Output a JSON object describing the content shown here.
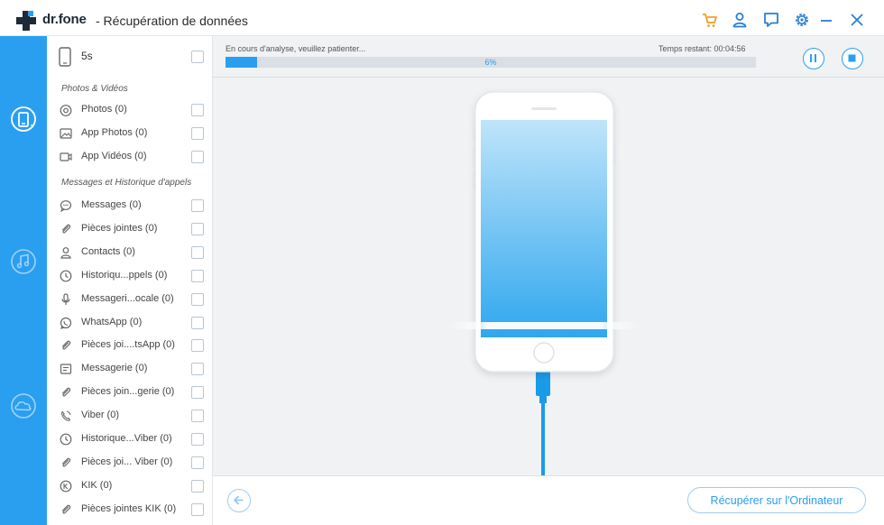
{
  "app": {
    "brand": "dr.fone",
    "title": "- Récupération de données"
  },
  "colors": {
    "accent": "#2a9ff0",
    "cart": "#f39c28",
    "rail": "#2a9ff0"
  },
  "titlebar_icons": [
    "cart-icon",
    "user-icon",
    "feedback-icon",
    "settings-icon",
    "minimize-icon",
    "close-icon"
  ],
  "rail_icons": [
    "device-recovery-icon",
    "itunes-recovery-icon",
    "icloud-recovery-icon"
  ],
  "device": {
    "label": "5s"
  },
  "sections": [
    {
      "title": "Photos & Vidéos",
      "items": [
        {
          "icon": "camera-icon",
          "label": "Photos (0)"
        },
        {
          "icon": "image-icon",
          "label": "App Photos (0)"
        },
        {
          "icon": "video-icon",
          "label": "App Vidéos (0)"
        }
      ]
    },
    {
      "title": "Messages et Historique d'appels",
      "items": [
        {
          "icon": "message-icon",
          "label": "Messages (0)"
        },
        {
          "icon": "attachment-icon",
          "label": "Pièces jointes (0)"
        },
        {
          "icon": "contact-icon",
          "label": "Contacts (0)"
        },
        {
          "icon": "clock-icon",
          "label": "Historiqu...ppels (0)"
        },
        {
          "icon": "microphone-icon",
          "label": "Messageri...ocale (0)"
        },
        {
          "icon": "whatsapp-icon",
          "label": "WhatsApp (0)"
        },
        {
          "icon": "attachment-icon",
          "label": "Pièces joi....tsApp (0)"
        },
        {
          "icon": "note-icon",
          "label": "Messagerie (0)"
        },
        {
          "icon": "attachment-icon",
          "label": "Pièces join...gerie  (0)"
        },
        {
          "icon": "viber-icon",
          "label": "Viber (0)"
        },
        {
          "icon": "clock-icon",
          "label": "Historique...Viber (0)"
        },
        {
          "icon": "attachment-icon",
          "label": "Pièces joi... Viber (0)"
        },
        {
          "icon": "kik-icon",
          "label": "KIK (0)"
        },
        {
          "icon": "attachment-icon",
          "label": "Pièces jointes KIK (0)"
        }
      ]
    }
  ],
  "scan": {
    "status": "En cours d'analyse, veuillez patienter...",
    "remaining": "Temps restant: 00:04:56",
    "progress_percent": 6,
    "progress_label": "6%"
  },
  "footer": {
    "recover_label": "Récupérer sur l'Ordinateur"
  }
}
